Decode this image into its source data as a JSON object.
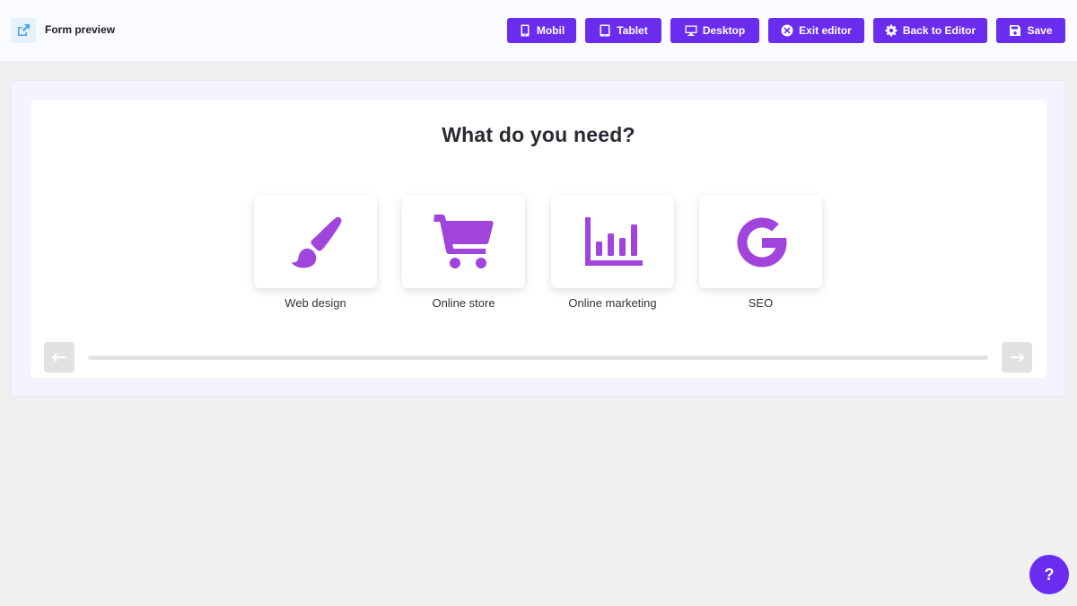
{
  "header": {
    "title": "Form preview",
    "buttons": {
      "mobile": "Mobil",
      "tablet": "Tablet",
      "desktop": "Desktop",
      "exit": "Exit editor",
      "back": "Back to Editor",
      "save": "Save"
    }
  },
  "form": {
    "question": "What do you need?",
    "options": [
      {
        "label": "Web design",
        "icon": "paintbrush-icon"
      },
      {
        "label": "Online store",
        "icon": "shopping-cart-icon"
      },
      {
        "label": "Online marketing",
        "icon": "bar-chart-icon"
      },
      {
        "label": "SEO",
        "icon": "google-icon"
      }
    ],
    "progress_percent": 0
  },
  "help": {
    "label": "?"
  },
  "colors": {
    "accent": "#6a2df0",
    "icon": "#a044dc",
    "background": "#f0f0f0"
  }
}
